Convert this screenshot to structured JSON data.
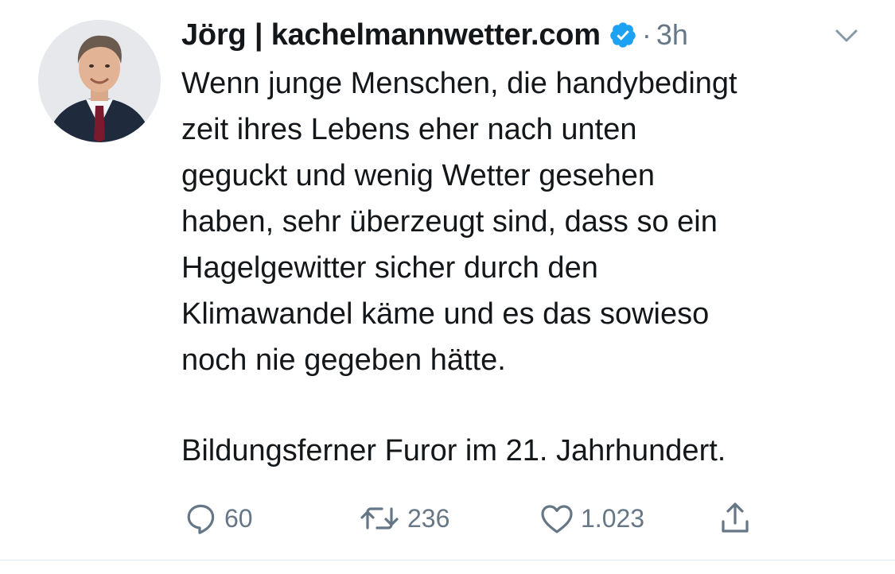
{
  "tweet": {
    "display_name": "Jörg | kachelmannwetter.com",
    "verified": true,
    "separator": "·",
    "time": "3h",
    "text_lines": [
      "Wenn junge Menschen, die handybedingt",
      "zeit ihres Lebens eher nach unten",
      "geguckt und wenig Wetter gesehen",
      "haben, sehr überzeugt sind, dass so ein",
      "Hagelgewitter sicher durch den",
      "Klimawandel käme und es das sowieso",
      "noch nie gegeben hätte."
    ],
    "closing_line": "Bildungsferner Furor im 21. Jahrhundert."
  },
  "actions": {
    "reply": {
      "icon": "reply-icon",
      "count": "60"
    },
    "retweet": {
      "icon": "retweet-icon",
      "count": "236"
    },
    "like": {
      "icon": "heart-icon",
      "count": "1.023"
    },
    "share": {
      "icon": "share-icon"
    }
  },
  "colors": {
    "text": "#14171a",
    "secondary": "#657786",
    "verified": "#1da1f2",
    "divider": "#e1e8ed"
  }
}
